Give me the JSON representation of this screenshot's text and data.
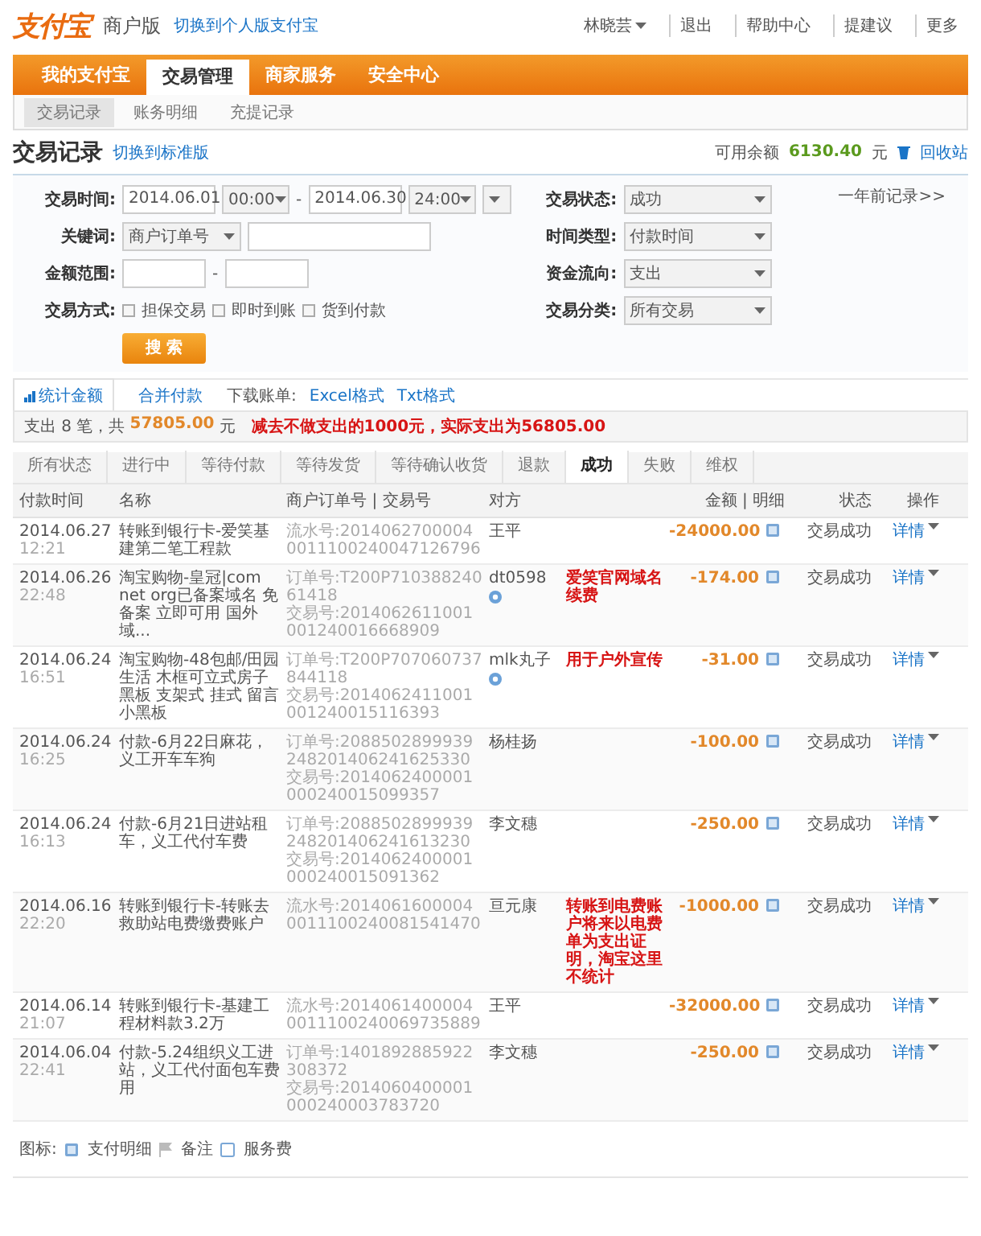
{
  "header": {
    "logo": "支付宝",
    "edition": "商户版",
    "switch_link": "切换到个人版支付宝",
    "user": "林晓芸",
    "links": [
      "退出",
      "帮助中心",
      "提建议"
    ],
    "more": "更多"
  },
  "nav": {
    "tabs": [
      {
        "label": "我的支付宝",
        "selected": false
      },
      {
        "label": "交易管理",
        "selected": true
      },
      {
        "label": "商家服务",
        "selected": false
      },
      {
        "label": "安全中心",
        "selected": false
      }
    ],
    "subtabs": [
      {
        "label": "交易记录",
        "selected": true
      },
      {
        "label": "账务明细",
        "selected": false
      },
      {
        "label": "充提记录",
        "selected": false
      }
    ]
  },
  "title": {
    "text": "交易记录",
    "switch_link": "切换到标准版",
    "balance_label": "可用余额",
    "balance": "6130.40",
    "unit": "元",
    "recycle": "回收站"
  },
  "filters": {
    "time_label": "交易时间:",
    "start_date": "2014.06.01",
    "start_time": "00:00",
    "dash": "-",
    "end_date": "2014.06.30",
    "end_time": "24:00",
    "keyword_label": "关键词:",
    "keyword_type": "商户订单号",
    "amount_label": "金额范围:",
    "method_label": "交易方式:",
    "methods": [
      {
        "label": "担保交易",
        "checked": false
      },
      {
        "label": "即时到账",
        "checked": false
      },
      {
        "label": "货到付款",
        "checked": false
      }
    ],
    "right": [
      {
        "label": "交易状态:",
        "value": "成功"
      },
      {
        "label": "时间类型:",
        "value": "付款时间"
      },
      {
        "label": "资金流向:",
        "value": "支出"
      },
      {
        "label": "交易分类:",
        "value": "所有交易"
      }
    ],
    "older_link": "一年前记录>>",
    "search_button": "搜 索"
  },
  "tools": {
    "tabs": [
      {
        "label": "统计金额",
        "selected": true
      },
      {
        "label": "合并付款",
        "selected": false
      }
    ],
    "download_label": "下载账单:",
    "formats": [
      "Excel格式",
      "Txt格式"
    ]
  },
  "summary": {
    "prefix": "支出 8 笔，共",
    "total": "57805.00",
    "unit": "元",
    "annotation": "减去不做支出的1000元，实际支出为56805.00"
  },
  "status_tabs": [
    {
      "label": "所有状态",
      "selected": false
    },
    {
      "label": "进行中",
      "selected": false
    },
    {
      "label": "等待付款",
      "selected": false
    },
    {
      "label": "等待发货",
      "selected": false
    },
    {
      "label": "等待确认收货",
      "selected": false
    },
    {
      "label": "退款",
      "selected": false
    },
    {
      "label": "成功",
      "selected": true
    },
    {
      "label": "失败",
      "selected": false
    },
    {
      "label": "维权",
      "selected": false
    }
  ],
  "table": {
    "separator": "|",
    "columns": [
      "付款时间",
      "名称",
      "商户订单号",
      "交易号",
      "对方",
      "金额",
      "明细",
      "状态",
      "操作"
    ],
    "rows": [
      {
        "date": "2014.06.27",
        "time": "12:21",
        "name": "转账到银行卡-爱笑基建第二笔工程款",
        "ids": [
          "流水号:20140627000040011100240047126796"
        ],
        "party": "王平",
        "chat": false,
        "note": "",
        "amount": "-24000.00",
        "status": "交易成功",
        "action": "详情"
      },
      {
        "date": "2014.06.26",
        "time": "22:48",
        "name": "淘宝购物-皇冠|com net org已备案域名 免备案 立即可用 国外域...",
        "ids": [
          "订单号:T200P71038824061418",
          "交易号:2014062611001001240016668909"
        ],
        "party": "dt0598",
        "chat": true,
        "note": "爱笑官网域名续费",
        "amount": "-174.00",
        "status": "交易成功",
        "action": "详情"
      },
      {
        "date": "2014.06.24",
        "time": "16:51",
        "name": "淘宝购物-48包邮/田园生活 木框可立式房子黑板 支架式 挂式 留言小黑板",
        "ids": [
          "订单号:T200P707060737844118",
          "交易号:2014062411001001240015116393"
        ],
        "party": "mlk丸子",
        "chat": true,
        "note": "用于户外宣传",
        "amount": "-31.00",
        "status": "交易成功",
        "action": "详情"
      },
      {
        "date": "2014.06.24",
        "time": "16:25",
        "name": "付款-6月22日麻花，义工开车车狗",
        "ids": [
          "订单号:2088502899939248201406241625330",
          "交易号:2014062400001000240015099357"
        ],
        "party": "杨桂扬",
        "chat": false,
        "note": "",
        "amount": "-100.00",
        "status": "交易成功",
        "action": "详情"
      },
      {
        "date": "2014.06.24",
        "time": "16:13",
        "name": "付款-6月21日进站租车，义工代付车费",
        "ids": [
          "订单号:2088502899939248201406241613230",
          "交易号:2014062400001000240015091362"
        ],
        "party": "李文穗",
        "chat": false,
        "note": "",
        "amount": "-250.00",
        "status": "交易成功",
        "action": "详情"
      },
      {
        "date": "2014.06.16",
        "time": "22:20",
        "name": "转账到银行卡-转账去救助站电费缴费账户",
        "ids": [
          "流水号:20140616000040011100240081541470"
        ],
        "party": "亘元康",
        "chat": false,
        "note": "转账到电费账户将来以电费单为支出证明，淘宝这里不统计",
        "amount": "-1000.00",
        "status": "交易成功",
        "action": "详情"
      },
      {
        "date": "2014.06.14",
        "time": "21:07",
        "name": "转账到银行卡-基建工程材料款3.2万",
        "ids": [
          "流水号:20140614000040011100240069735889"
        ],
        "party": "王平",
        "chat": false,
        "note": "",
        "amount": "-32000.00",
        "status": "交易成功",
        "action": "详情"
      },
      {
        "date": "2014.06.04",
        "time": "22:41",
        "name": "付款-5.24组织义工进站，义工代付面包车费用",
        "ids": [
          "订单号:1401892885922308372",
          "交易号:2014060400001000240003783720"
        ],
        "party": "李文穗",
        "chat": false,
        "note": "",
        "amount": "-250.00",
        "status": "交易成功",
        "action": "详情"
      }
    ]
  },
  "legend": {
    "label": "图标:",
    "items": [
      {
        "kind": "detail",
        "label": "支付明细"
      },
      {
        "kind": "flag",
        "label": "备注"
      },
      {
        "kind": "fee",
        "label": "服务费"
      }
    ]
  }
}
